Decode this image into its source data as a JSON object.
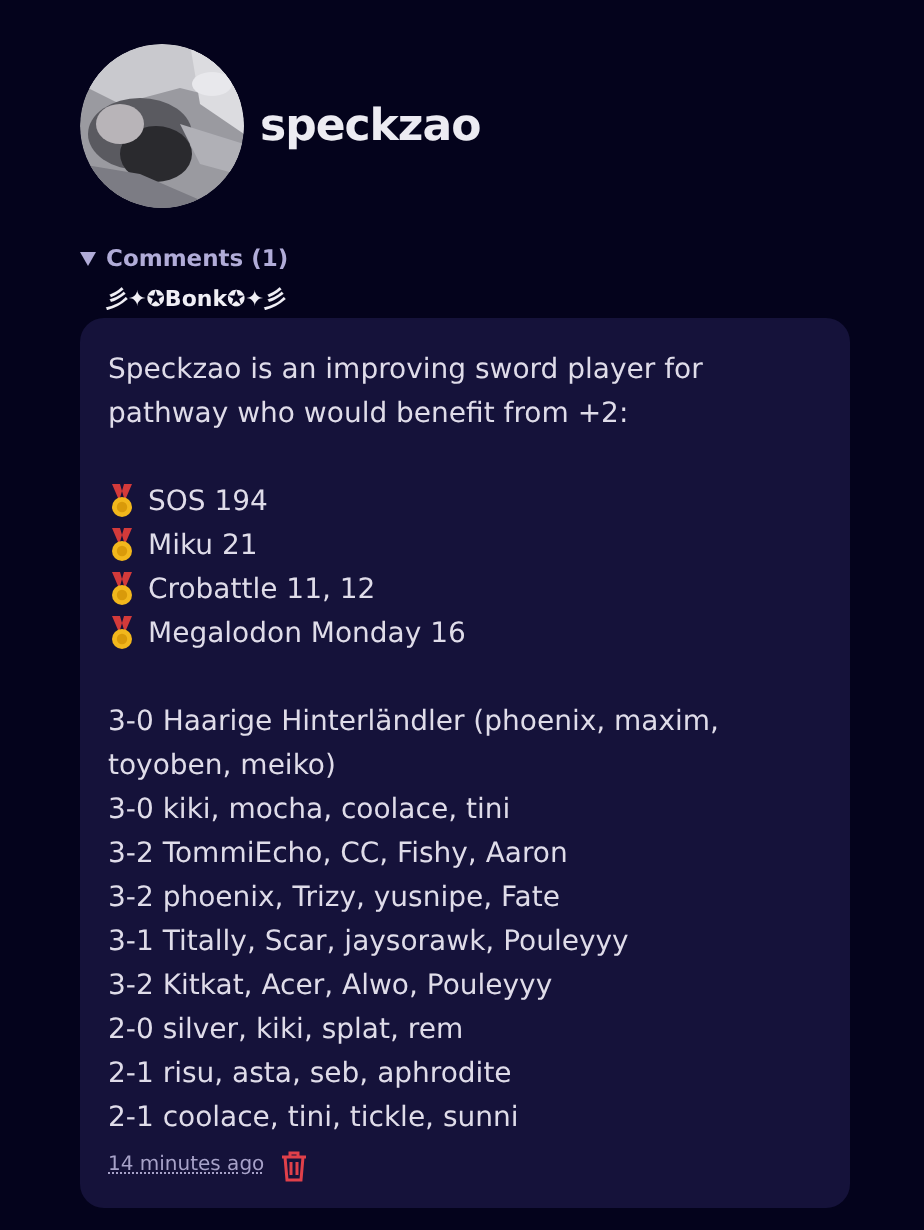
{
  "profile": {
    "username": "speckzao"
  },
  "comments": {
    "summary": "Comments (1)",
    "expanded": true,
    "items": [
      {
        "author": "彡✦✪Bonk✪✦彡",
        "intro": "Speckzao is an improving sword player for pathway who would benefit from +2:",
        "medals": [
          "SOS 194",
          "Miku 21",
          "Crobattle 11, 12",
          "Megalodon Monday 16"
        ],
        "results": [
          "3-0 Haarige Hinterländler (phoenix, maxim, toyoben, meiko)",
          "3-0 kiki, mocha, coolace, tini",
          "3-2 TommiEcho, CC, Fishy, Aaron",
          "3-2 phoenix, Trizy, yusnipe, Fate",
          "3-1 Titally, Scar, jaysorawk, Pouleyyy",
          "3-2 Kitkat, Acer, Alwo, Pouleyyy",
          "2-0 silver, kiki, splat, rem",
          "2-1 risu, asta, seb, aphrodite",
          "2-1 coolace, tini, tickle, sunni"
        ],
        "time": "14 minutes ago"
      }
    ]
  }
}
